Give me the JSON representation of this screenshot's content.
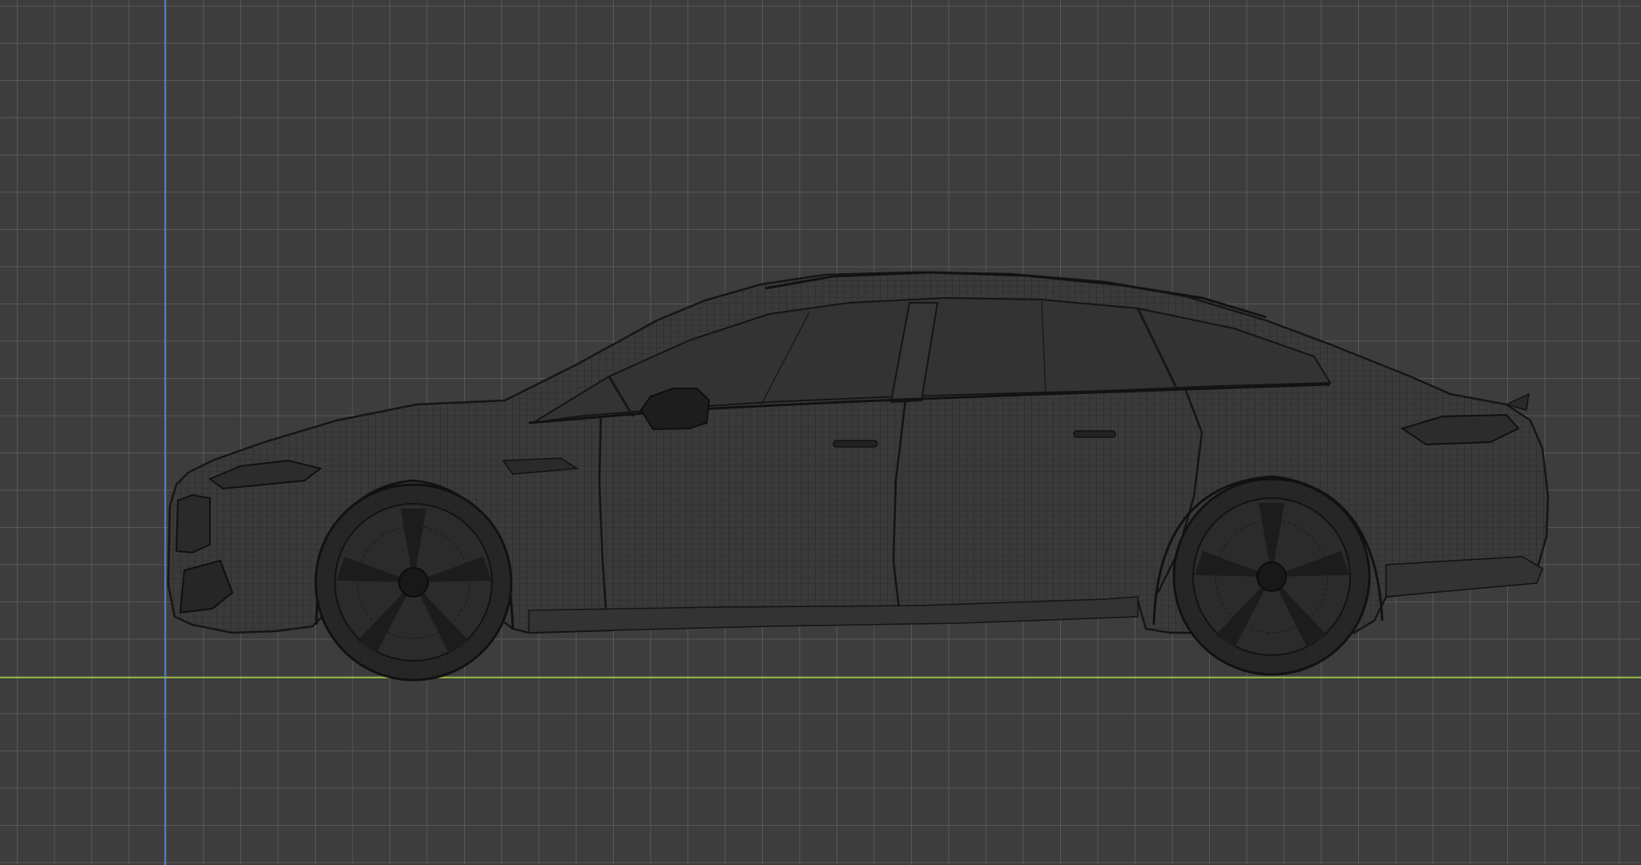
{
  "viewport": {
    "view": "side-orthographic",
    "shading": "wireframe",
    "background_color": "#3d3d3d",
    "grid_color": "#787878",
    "axis_colors": {
      "x_axis": "#8fb03a",
      "z_axis": "#4d78c8"
    }
  },
  "model": {
    "object": "car",
    "body_color": "#3a3a3a",
    "wire_color": "#1e1e1e",
    "wheel_color": "#1c1c1c",
    "wheels": [
      "front-wheel",
      "rear-wheel"
    ],
    "icons": [
      "side-mirror-icon",
      "door-handle-icon"
    ]
  }
}
